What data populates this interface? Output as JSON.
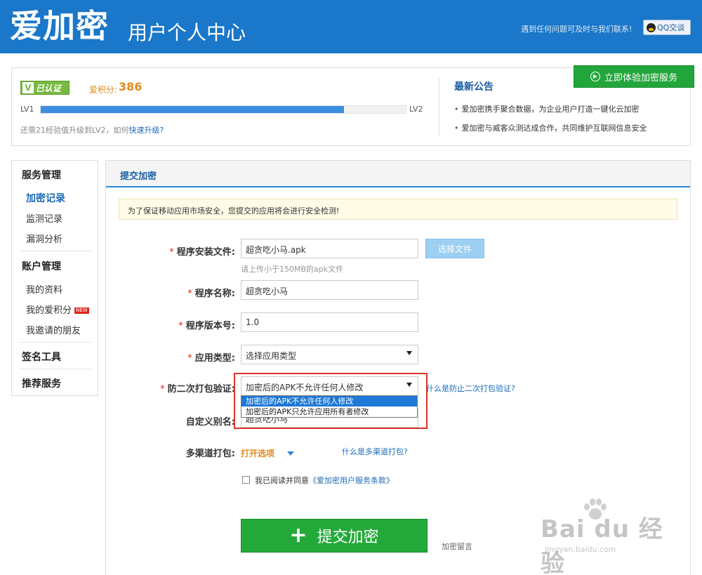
{
  "header": {
    "logo": "爱加密",
    "subtitle": "用户个人中心",
    "contact": "遇到任何问题可及时与我们联系!",
    "qq_button": "QQ交谈"
  },
  "profile": {
    "verified_badge": "已认证",
    "points_label": "爱积分:",
    "points_value": "386",
    "level_start": "LV1",
    "level_end": "LV2",
    "level_progress": 0.83,
    "upgrade_tip": "还需21经验值升级到LV2，如何",
    "upgrade_link": "快速升级?"
  },
  "notice": {
    "title": "最新公告",
    "items": [
      "爱加密携手聚合数据，为企业用户打造一键化云加密",
      "爱加密与威客众测达成合作，共同维护互联网信息安全"
    ],
    "try_button": "立即体验加密服务"
  },
  "sidebar": {
    "group_service": "服务管理",
    "items_service": [
      "加密记录",
      "监测记录",
      "漏洞分析"
    ],
    "group_account": "账户管理",
    "items_account": [
      "我的资料",
      "我的爱积分",
      "我邀请的朋友"
    ],
    "new_badge": "NEW",
    "group_sign": "签名工具",
    "group_recommend": "推荐服务"
  },
  "form": {
    "title": "提交加密",
    "alert": "为了保证移动应用市场安全，您提交的应用将会进行安全检测!",
    "required_mark": "*",
    "file_label": "程序安装文件:",
    "file_value": "超贪吃小马.apk",
    "choose_button": "选择文件",
    "file_hint": "请上传小于150MB的apk文件",
    "name_label": "程序名称:",
    "name_value": "超贪吃小马",
    "version_label": "程序版本号:",
    "version_value": "1.0",
    "type_label": "应用类型:",
    "type_value": "选择应用类型",
    "repack_label": "防二次打包验证:",
    "repack_value": "加密后的APK不允许任何人修改",
    "repack_options": [
      "加密后的APK不允许任何人修改",
      "加密后的APK只允许应用所有者修改"
    ],
    "repack_help": "什么是防止二次打包验证?",
    "alias_label": "自定义别名:",
    "alias_value": "超贪吃小马",
    "channel_label": "多渠道打包:",
    "channel_toggle": "打开选项",
    "channel_help": "什么是多渠道打包?",
    "agree_text": "我已阅读并同意",
    "agree_link": "《爱加密用户服务条款》",
    "submit_button": "提交加密",
    "submit_note": "加密留言"
  },
  "watermark": {
    "brand": "Bai du 经验",
    "url": "jingyan.baidu.com"
  },
  "colors": {
    "header_bg": "#1a77c9",
    "accent_blue": "#2b86d6",
    "green": "#23a93a",
    "orange": "#e18a1c",
    "highlight_red": "#d9352c"
  }
}
